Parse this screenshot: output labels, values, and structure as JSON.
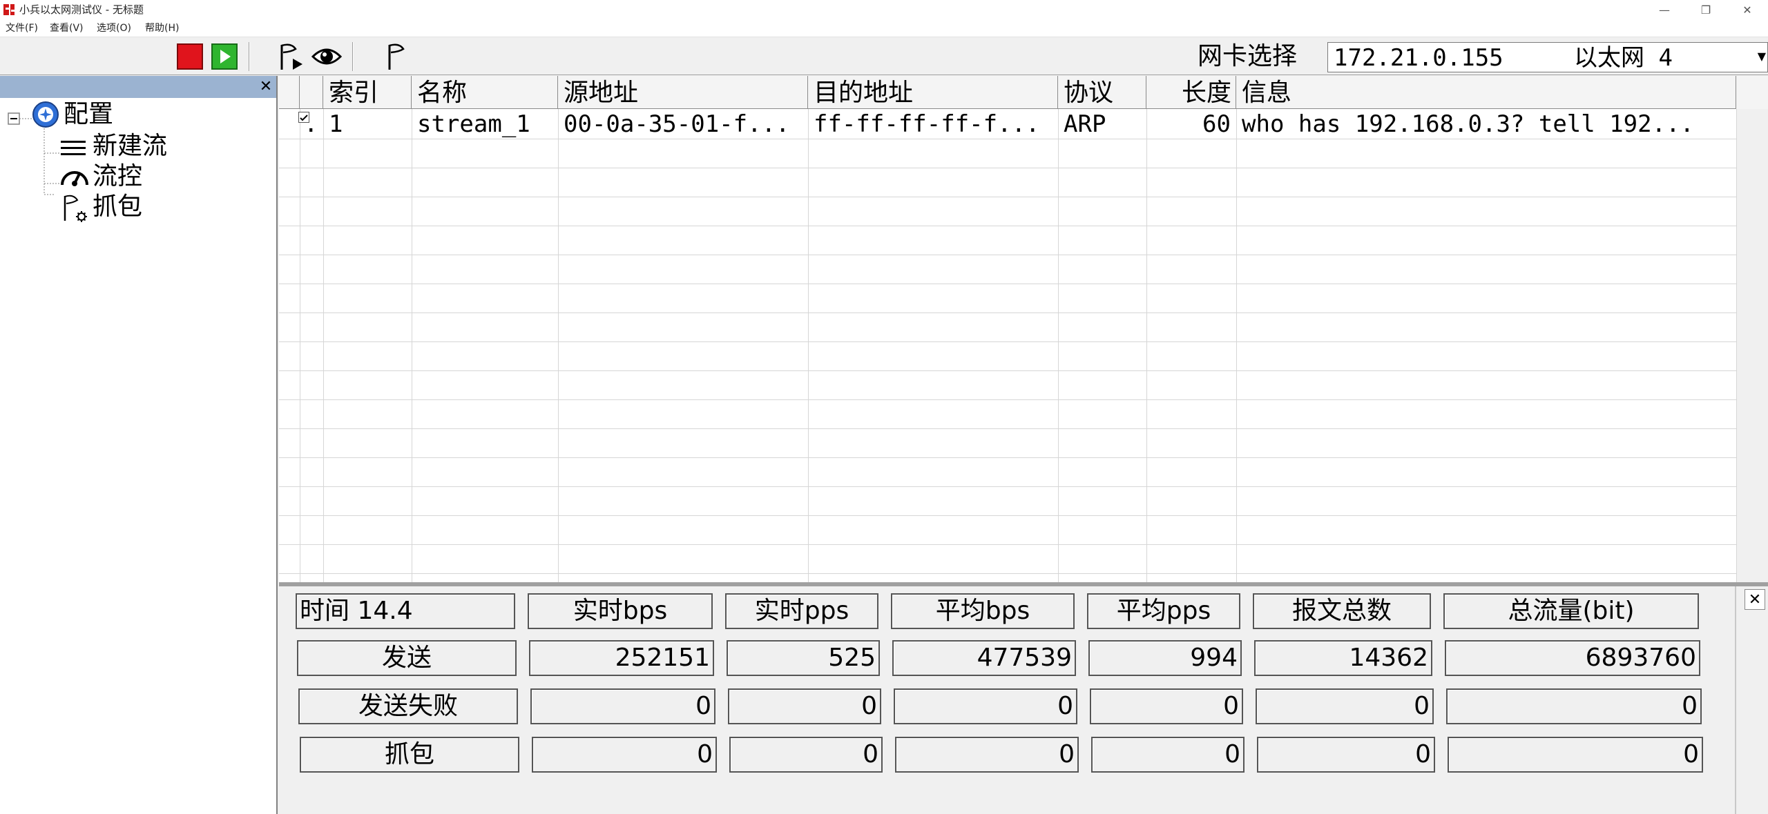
{
  "window": {
    "title": "小兵以太网测试仪 - 无标题",
    "controls": [
      "minimize",
      "restore",
      "close"
    ]
  },
  "menu": [
    "文件(F)",
    "查看(V)",
    "选项(O)",
    "帮助(H)"
  ],
  "toolbar": {
    "buttons": [
      "stop-icon",
      "play-icon",
      "capture-flag-icon",
      "eye-icon",
      "flag-icon"
    ],
    "nic_label": "网卡选择",
    "nic_value": "172.21.0.155     以太网 4"
  },
  "tree": {
    "root": "配置",
    "children": [
      "新建流",
      "流控",
      "抓包"
    ]
  },
  "table": {
    "headers": [
      "索引",
      "名称",
      "源地址",
      "目的地址",
      "协议",
      "长度",
      "信息"
    ],
    "rows": [
      {
        "checked": true,
        "marker": ".",
        "index": "1",
        "name": "stream_1",
        "src": "00-0a-35-01-f...",
        "dst": "ff-ff-ff-ff-f...",
        "proto": "ARP",
        "length": "60",
        "info": "who has 192.168.0.3? tell 192..."
      }
    ]
  },
  "stats": {
    "time_label": "时间 14.4",
    "headers": [
      "实时bps",
      "实时pps",
      "平均bps",
      "平均pps",
      "报文总数",
      "总流量(bit)"
    ],
    "rows": [
      {
        "label": "发送",
        "values": [
          "252151",
          "525",
          "477539",
          "994",
          "14362",
          "6893760"
        ]
      },
      {
        "label": "发送失败",
        "values": [
          "0",
          "0",
          "0",
          "0",
          "0",
          "0"
        ]
      },
      {
        "label": "抓包",
        "values": [
          "0",
          "0",
          "0",
          "0",
          "0",
          "0"
        ]
      }
    ]
  },
  "colors": {
    "stop": "#e0141c",
    "play": "#2fb52f",
    "panel_header": "#9bb3d1"
  }
}
